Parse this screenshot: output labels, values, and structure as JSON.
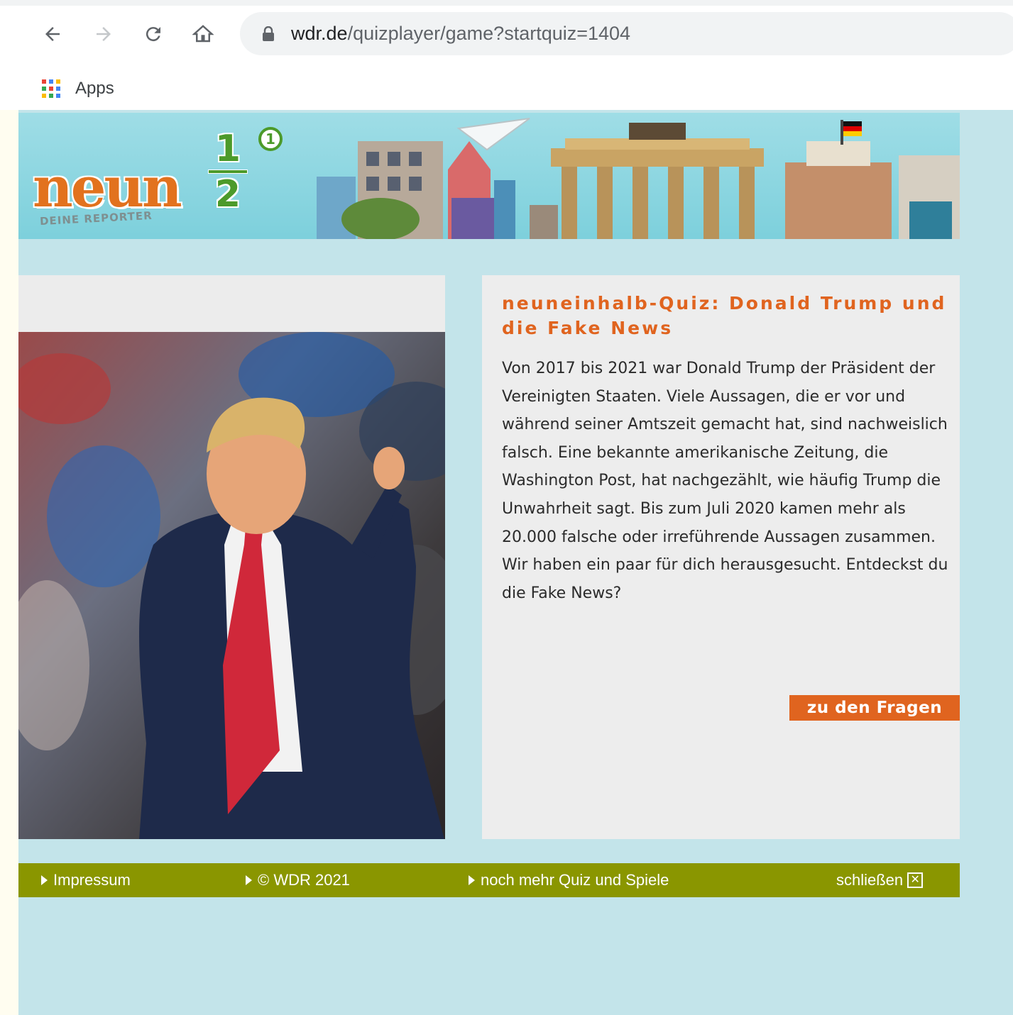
{
  "browser": {
    "url_host": "wdr.de",
    "url_path": "/quizplayer/game?startquiz=1404",
    "bookmarks": [
      {
        "label": "Apps"
      }
    ]
  },
  "banner": {
    "logo_word": "neun",
    "logo_numerator": "1",
    "logo_denominator": "2",
    "logo_channel": "1",
    "logo_tagline": "DEINE REPORTER"
  },
  "quiz": {
    "title": "neuneinhalb-Quiz: Donald Trump und die Fake News",
    "description": "Von 2017 bis 2021 war Donald Trump der Präsident der Vereinigten Staaten. Viele Aussagen, die er vor und während seiner Amtszeit gemacht hat, sind nachweislich falsch. Eine bekannte amerikanische Zeitung, die Washington Post, hat nachgezählt, wie häufig Trump die Unwahrheit sagt. Bis zum Juli 2020 kamen mehr als 20.000 falsche oder irreführende Aussagen zusammen. Wir haben ein paar für dich herausgesucht. Entdeckst du die Fake News?",
    "start_label": "zu den Fragen"
  },
  "footer": {
    "impressum": "Impressum",
    "copyright": "© WDR 2021",
    "more": "noch mehr Quiz und Spiele",
    "close": "schließen"
  },
  "colors": {
    "accent_orange": "#e0641f",
    "footer_green": "#8a9600",
    "page_background": "#c3e4ea"
  }
}
